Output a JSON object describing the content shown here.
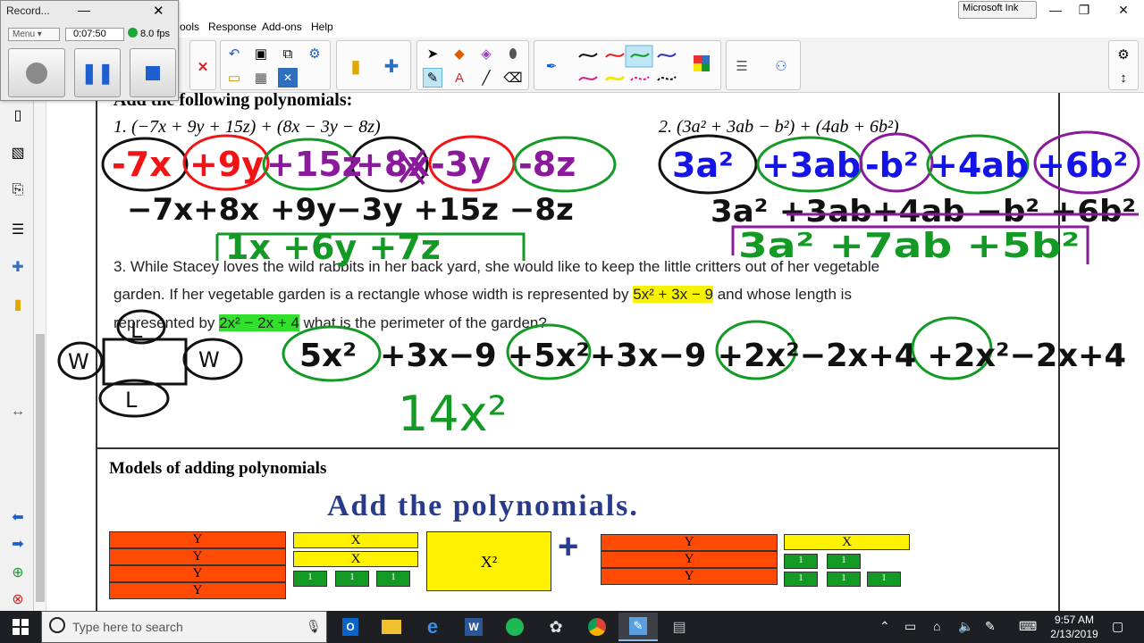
{
  "window": {
    "menu": [
      "ools",
      "Response",
      "Add-ons",
      "Help"
    ],
    "ink_label": "Microsoft Ink",
    "controls": [
      "—",
      "❐",
      "✕"
    ]
  },
  "recorder": {
    "title": "Record...",
    "menu_label": "Menu",
    "time": "0:07:50",
    "fps": "8.0 fps"
  },
  "page": {
    "heading": "Add the following polynomials:",
    "problem1": "1. (−7x + 9y + 15z) + (8x − 3y − 8z)",
    "problem2": "2. (3a² + 3ab − b²) + (4ab + 6b²)",
    "problem3": {
      "line1": "3. While Stacey loves the wild rabbits in her back yard, she would like to keep the little critters out of her vegetable",
      "line2_a": "garden. If her vegetable garden is a rectangle whose width is represented by ",
      "line2_width": "5x² + 3x − 9",
      "line2_b": " and whose length is",
      "line3_a": "represented by ",
      "line3_length": "2x² − 2x + 4",
      "line3_b": " what is the perimeter of the garden?"
    },
    "models_heading": "Models of adding polynomials",
    "add_title": "Add the polynomials.",
    "tile_labels": {
      "y": "Y",
      "x": "X",
      "one": "1",
      "x2": "X²"
    }
  },
  "handwriting": {
    "p1_terms": [
      "-7x",
      "+9y",
      "+15z",
      "+8x",
      "-3y",
      "-8z"
    ],
    "p1_line2": "−7x+8x +9y−3y +15z −8z",
    "p1_answer": "1x +6y +7z",
    "p2_terms": [
      "3a²",
      "+3ab",
      "-b²",
      "+4ab",
      "+6b²"
    ],
    "p2_line2": "3a² +3ab+4ab −b² +6b²",
    "p2_answer": "3a² +7ab +5b²",
    "p3_line": "+3x−9 +5x²+3x−9 +2x²−2x+4 +2x²−2x+4",
    "p3_term1": "5x²",
    "p3_answer": "14x²",
    "rect_labels": [
      "L",
      "W",
      "W",
      "L"
    ]
  },
  "taskbar": {
    "search_placeholder": "Type here to search",
    "time": "9:57 AM",
    "date": "2/13/2019"
  },
  "colors": {
    "ink_red": "#f21414",
    "ink_green": "#129a24",
    "ink_purple": "#8a1a9b",
    "ink_blue": "#1414e6",
    "ink_black": "#111111"
  }
}
